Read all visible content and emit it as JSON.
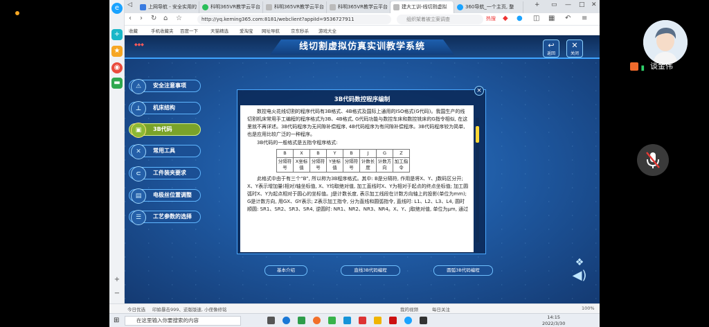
{
  "browser": {
    "tabs": [
      {
        "label": "上网导航 - 安全实用的",
        "active": false
      },
      {
        "label": "科明365VR教学云平台",
        "active": false
      },
      {
        "label": "科明365VR教学云平台",
        "active": false
      },
      {
        "label": "科明365VR教学云平台",
        "active": false
      },
      {
        "label": "建大工训-线切割虚拟",
        "active": true
      },
      {
        "label": "360导航_一个主页, 整",
        "active": false
      }
    ],
    "new_tab_label": "+",
    "url": "http://yq.keming365.com:8181/webclient?appiId=9536727911",
    "search_placeholder": "组织架着被立案调查",
    "hot_label": "热搜",
    "bookmarks": [
      "收藏",
      "手机收藏夹",
      "百度一下",
      "天猫精选",
      "爱淘宝",
      "网址导航",
      "京东秒杀",
      "游戏大全"
    ],
    "status": {
      "left": "今日优选",
      "news": "印娘暴击999、逆版版速, 小侄像修铭",
      "mid1": "我的视频",
      "mid2": "每日关注",
      "zoom": "100%"
    }
  },
  "app": {
    "title": "线切割虚拟仿真实训教学系统",
    "back_label": "返回",
    "close_label": "关闭",
    "menu": [
      {
        "label": "安全注意事项",
        "active": false,
        "icon": "warning-icon"
      },
      {
        "label": "机床结构",
        "active": false,
        "icon": "machine-icon"
      },
      {
        "label": "3B代码",
        "active": true,
        "icon": "code-icon"
      },
      {
        "label": "常用工具",
        "active": false,
        "icon": "tools-icon"
      },
      {
        "label": "工件装夹要求",
        "active": false,
        "icon": "clamp-icon"
      },
      {
        "label": "电极丝位置调整",
        "active": false,
        "icon": "wire-icon"
      },
      {
        "label": "工艺参数的选择",
        "active": false,
        "icon": "params-icon"
      }
    ],
    "dialog": {
      "title": "3B代码数控程序编制",
      "close_label": "×",
      "para1": "数控电火花线切割的程序代码有3B格式、4B格式及国际上通用的ISO格式(G代码)。我国生产的线切割机床常用手工编程的程序格式为3B、4B格式, G代码功能与数控车床和数控铣床的G指令相似, 在这里就不再详述。3B代码程序为无间隙补偿程序, 4B代码程序为有间隙补偿程序。3B代码程序较为简单, 也是应用比较广泛的一种程序。",
      "format_line": "3B代码的一般格式是五指令程序格式:",
      "table_head": [
        "B",
        "X",
        "B",
        "Y",
        "B",
        "J",
        "G",
        "Z"
      ],
      "table_row": [
        "分隔符号",
        "X坐标值",
        "分隔符号",
        "Y坐标值",
        "分隔符号",
        "计数长度",
        "计数方向",
        "加工指令"
      ],
      "para2": "此格式中由于有三个“B”, 所以称为3B程序格式。其中: B是分隔符, 作用是将X、Y、J数码区分开; X、Y表示增加量(相对)轴坐标值, X、Y均取绝对值, 加工直线时X、Y为相对于起点的终点坐标值; 加工圆弧时X、Y为起点相对于圆心的坐标值。J是计数长度, 表示加工线段在计数方向轴上的投影(单位为mm); G是计数方向, 用GX、GY表示; Z表示加工指令, 分为直线和圆弧指令, 直线时: L1、L2、L3、L4, 圆时顺圆: SR1、SR2、SR3、SR4, 逆圆时: NR1、NR2、NR3、NR4。X、Y、J取绝对值, 单位为μm, 通过"
    },
    "bottom_buttons": [
      "基本介绍",
      "直线3B代码编程",
      "圆弧3B代码编程"
    ]
  },
  "taskbar": {
    "search_placeholder": "在这里输入你要搜索的内容",
    "time": "14:15",
    "date": "2022/3/30"
  },
  "call": {
    "name": "谈金伟"
  }
}
